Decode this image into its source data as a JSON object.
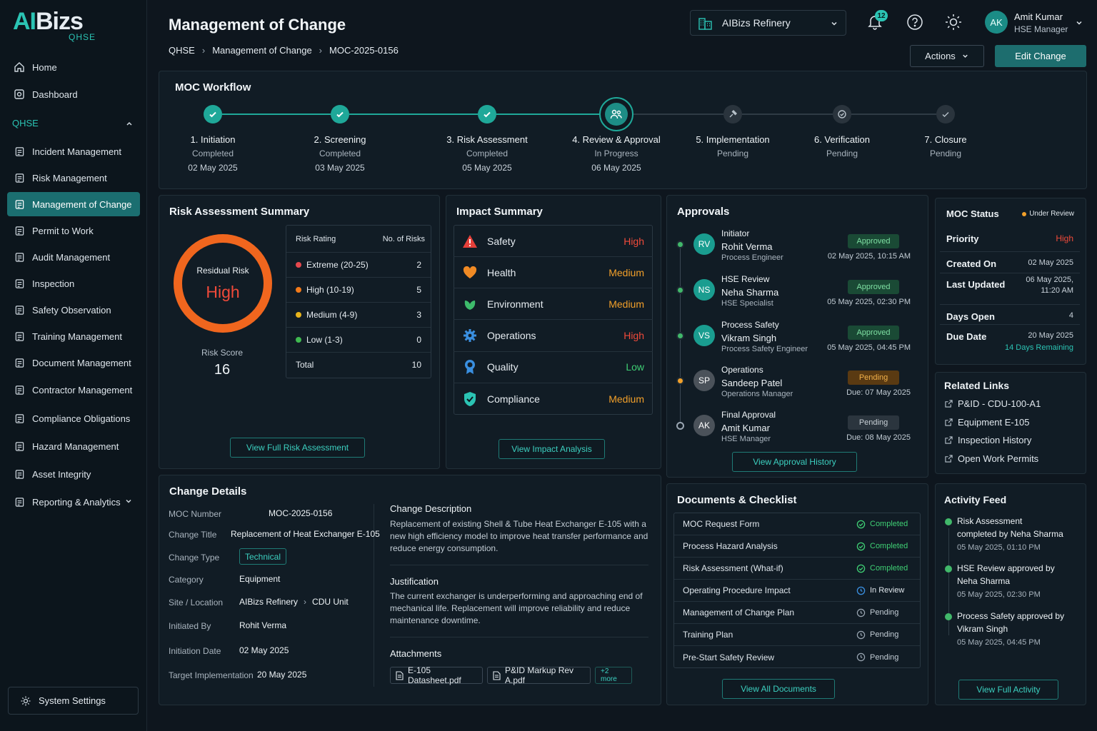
{
  "app": {
    "logo_text": "AIBizs",
    "logo_sub": "QHSE"
  },
  "sidebar": {
    "items_top": [
      {
        "label": "Home",
        "icon": "home-icon"
      },
      {
        "label": "Dashboard",
        "icon": "dashboard-icon"
      }
    ],
    "section": "QHSE",
    "items": [
      {
        "label": "Incident Management"
      },
      {
        "label": "Risk Management"
      },
      {
        "label": "Management of Change",
        "active": true
      },
      {
        "label": "Permit to Work"
      },
      {
        "label": "Audit Management"
      },
      {
        "label": "Inspection"
      },
      {
        "label": "Safety Observation"
      },
      {
        "label": "Training Management"
      },
      {
        "label": "Document Management"
      },
      {
        "label": "Contractor Management"
      },
      {
        "label": "Compliance Obligations"
      },
      {
        "label": "Hazard Management"
      },
      {
        "label": "Asset Integrity"
      },
      {
        "label": "Reporting & Analytics"
      }
    ],
    "settings": "System Settings"
  },
  "header": {
    "title": "Management of Change",
    "breadcrumb": [
      "QHSE",
      "Management of Change",
      "MOC-2025-0156"
    ],
    "site": "AIBizs Refinery",
    "notifications": "12",
    "user": {
      "initials": "AK",
      "name": "Amit Kumar",
      "role": "HSE Manager"
    },
    "actions_label": "Actions",
    "edit_label": "Edit Change"
  },
  "workflow": {
    "title": "MOC Workflow",
    "steps": [
      {
        "name": "1. Initiation",
        "status": "Completed",
        "date": "02 May 2025"
      },
      {
        "name": "2. Screening",
        "status": "Completed",
        "date": "03 May 2025"
      },
      {
        "name": "3. Risk Assessment",
        "status": "Completed",
        "date": "05 May 2025"
      },
      {
        "name": "4. Review & Approval",
        "status": "In Progress",
        "date": "06 May 2025"
      },
      {
        "name": "5. Implementation",
        "status": "Pending",
        "date": ""
      },
      {
        "name": "6. Verification",
        "status": "Pending",
        "date": ""
      },
      {
        "name": "7. Closure",
        "status": "Pending",
        "date": ""
      }
    ]
  },
  "risk": {
    "title": "Risk Assessment Summary",
    "residual_label": "Residual Risk",
    "residual_value": "High",
    "score_label": "Risk Score",
    "score": "16",
    "col_rating": "Risk Rating",
    "col_count": "No. of Risks",
    "rows": [
      {
        "label": "Extreme (20-25)",
        "count": "2",
        "color": "#e5484d"
      },
      {
        "label": "High (10-19)",
        "count": "5",
        "color": "#f27a1a"
      },
      {
        "label": "Medium (4-9)",
        "count": "3",
        "color": "#e8b41b"
      },
      {
        "label": "Low (1-3)",
        "count": "0",
        "color": "#3fb950"
      }
    ],
    "total_label": "Total",
    "total": "10",
    "button": "View Full Risk Assessment"
  },
  "impact": {
    "title": "Impact Summary",
    "rows": [
      {
        "label": "Safety",
        "level": "High",
        "color": "#f04a3a",
        "icon": "warning-icon"
      },
      {
        "label": "Health",
        "level": "Medium",
        "color": "#f2a02a",
        "icon": "heart-icon"
      },
      {
        "label": "Environment",
        "level": "Medium",
        "color": "#f2a02a",
        "icon": "leaf-icon"
      },
      {
        "label": "Operations",
        "level": "High",
        "color": "#f04a3a",
        "icon": "gear-icon"
      },
      {
        "label": "Quality",
        "level": "Low",
        "color": "#3fcf74",
        "icon": "medal-icon"
      },
      {
        "label": "Compliance",
        "level": "Medium",
        "color": "#f2a02a",
        "icon": "shield-check-icon"
      }
    ],
    "button": "View Impact Analysis"
  },
  "approvals": {
    "title": "Approvals",
    "items": [
      {
        "stage": "Initiator",
        "initials": "RV",
        "name": "Rohit Verma",
        "role": "Process Engineer",
        "status": "Approved",
        "date": "02 May 2025, 10:15 AM"
      },
      {
        "stage": "HSE Review",
        "initials": "NS",
        "name": "Neha Sharma",
        "role": "HSE Specialist",
        "status": "Approved",
        "date": "05 May 2025, 02:30 PM"
      },
      {
        "stage": "Process Safety",
        "initials": "VS",
        "name": "Vikram Singh",
        "role": "Process Safety Engineer",
        "status": "Approved",
        "date": "05 May 2025, 04:45 PM"
      },
      {
        "stage": "Operations",
        "initials": "SP",
        "name": "Sandeep Patel",
        "role": "Operations Manager",
        "status": "Pending",
        "date": "Due: 07 May 2025"
      },
      {
        "stage": "Final Approval",
        "initials": "AK",
        "name": "Amit Kumar",
        "role": "HSE Manager",
        "status": "Pending",
        "date": "Due: 08 May 2025"
      }
    ],
    "button": "View Approval History"
  },
  "status": {
    "title": "MOC Status",
    "state": "Under Review",
    "rows": [
      {
        "key": "Priority",
        "value": "High"
      },
      {
        "key": "Created On",
        "value": "02 May 2025"
      },
      {
        "key": "Last Updated",
        "value": "06 May 2025,",
        "value2": "11:20 AM"
      },
      {
        "key": "Days Open",
        "value": "4"
      },
      {
        "key": "Due Date",
        "value": "20 May 2025",
        "value2": "14 Days Remaining"
      }
    ]
  },
  "links": {
    "title": "Related Links",
    "items": [
      "P&ID - CDU-100-A1",
      "Equipment E-105",
      "Inspection History",
      "Open Work Permits"
    ]
  },
  "details": {
    "title": "Change Details",
    "fields": {
      "moc_number_label": "MOC Number",
      "moc_number": "MOC-2025-0156",
      "title_label": "Change Title",
      "title": "Replacement of Heat Exchanger E-105",
      "type_label": "Change Type",
      "type": "Technical",
      "category_label": "Category",
      "category": "Equipment",
      "site_label": "Site / Location",
      "site": "AIBizs Refinery",
      "unit": "CDU Unit",
      "initiated_label": "Initiated By",
      "initiated": "Rohit Verma",
      "init_date_label": "Initiation Date",
      "init_date": "02 May 2025",
      "target_label": "Target Implementation",
      "target": "20 May 2025"
    },
    "description_title": "Change Description",
    "description": "Replacement of existing Shell & Tube Heat Exchanger E-105 with a new high efficiency model to improve heat transfer performance and reduce energy consumption.",
    "justification_title": "Justification",
    "justification": "The current exchanger is underperforming and approaching end of mechanical life. Replacement will improve reliability and reduce maintenance downtime.",
    "attachments_title": "Attachments",
    "attachments": [
      "E-105 Datasheet.pdf",
      "P&ID Markup Rev A.pdf"
    ],
    "more": "+2 more"
  },
  "documents": {
    "title": "Documents & Checklist",
    "items": [
      {
        "label": "MOC Request Form",
        "status": "Completed"
      },
      {
        "label": "Process Hazard Analysis",
        "status": "Completed"
      },
      {
        "label": "Risk Assessment (What-if)",
        "status": "Completed"
      },
      {
        "label": "Operating Procedure Impact",
        "status": "In Review"
      },
      {
        "label": "Management of Change Plan",
        "status": "Pending"
      },
      {
        "label": "Training Plan",
        "status": "Pending"
      },
      {
        "label": "Pre-Start Safety Review",
        "status": "Pending"
      }
    ],
    "button": "View All Documents"
  },
  "activity": {
    "title": "Activity Feed",
    "items": [
      {
        "line1": "Risk Assessment",
        "line2": "completed by Neha Sharma",
        "date": "05 May 2025, 01:10 PM"
      },
      {
        "line1": "HSE Review approved by",
        "line2": "Neha Sharma",
        "date": "05 May 2025, 02:30 PM"
      },
      {
        "line1": "Process Safety approved by",
        "line2": "Vikram Singh",
        "date": "05 May 2025, 04:45 PM"
      }
    ],
    "button": "View Full Activity"
  }
}
